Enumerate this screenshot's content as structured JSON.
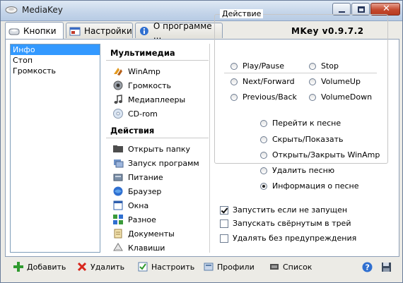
{
  "window": {
    "title": "MediaKey",
    "version": "MKey v0.9.7.2"
  },
  "tabs": [
    {
      "label": "Кнопки",
      "icon": "buttons-icon",
      "active": true
    },
    {
      "label": "Настройки",
      "icon": "settings-icon",
      "active": false
    },
    {
      "label": "О программе ...",
      "icon": "info-icon",
      "active": false
    }
  ],
  "list": {
    "items": [
      "Инфо",
      "Стоп",
      "Громкость"
    ],
    "selected": 0
  },
  "multimedia": {
    "header": "Мультимедиа",
    "items": [
      {
        "label": "WinAmp",
        "icon": "winamp-icon"
      },
      {
        "label": "Громкость",
        "icon": "speaker-icon"
      },
      {
        "label": "Медиаплееры",
        "icon": "music-note-icon"
      },
      {
        "label": "CD-rom",
        "icon": "cd-icon"
      }
    ]
  },
  "actions_section": {
    "header": "Действия",
    "items": [
      {
        "label": "Открыть папку",
        "icon": "folder-icon"
      },
      {
        "label": "Запуск программ",
        "icon": "programs-icon"
      },
      {
        "label": "Питание",
        "icon": "power-icon"
      },
      {
        "label": "Браузер",
        "icon": "browser-icon"
      },
      {
        "label": "Окна",
        "icon": "windows-icon"
      },
      {
        "label": "Разное",
        "icon": "misc-icon"
      },
      {
        "label": "Документы",
        "icon": "documents-icon"
      },
      {
        "label": "Клавиши",
        "icon": "keys-icon"
      }
    ]
  },
  "action_group": {
    "label": "Действие",
    "col1": [
      "Play/Pause",
      "Next/Forward",
      "Previous/Back"
    ],
    "col2": [
      "Stop",
      "VolumeUp",
      "VolumeDown"
    ],
    "song_options": [
      "Перейти к песне",
      "Скрыть/Показать",
      "Открыть/Закрыть WinAmp",
      "Удалить песню",
      "Информация о песне"
    ],
    "selected_song_option": 4
  },
  "options": {
    "run_if_not_running": {
      "label": "Запустить если не запущен",
      "checked": true
    },
    "start_minimized": {
      "label": "Запускать свёрнутым в трей",
      "checked": false
    },
    "delete_without_warning": {
      "label": "Удалять без предупреждения",
      "checked": false
    }
  },
  "bottom": {
    "add": "Добавить",
    "delete": "Удалить",
    "configure": "Настроить",
    "profiles": "Профили",
    "list": "Список"
  },
  "colors": {
    "selection": "#3399ff",
    "frame": "#ecebe6",
    "title_bar": "#c6d6ea"
  }
}
